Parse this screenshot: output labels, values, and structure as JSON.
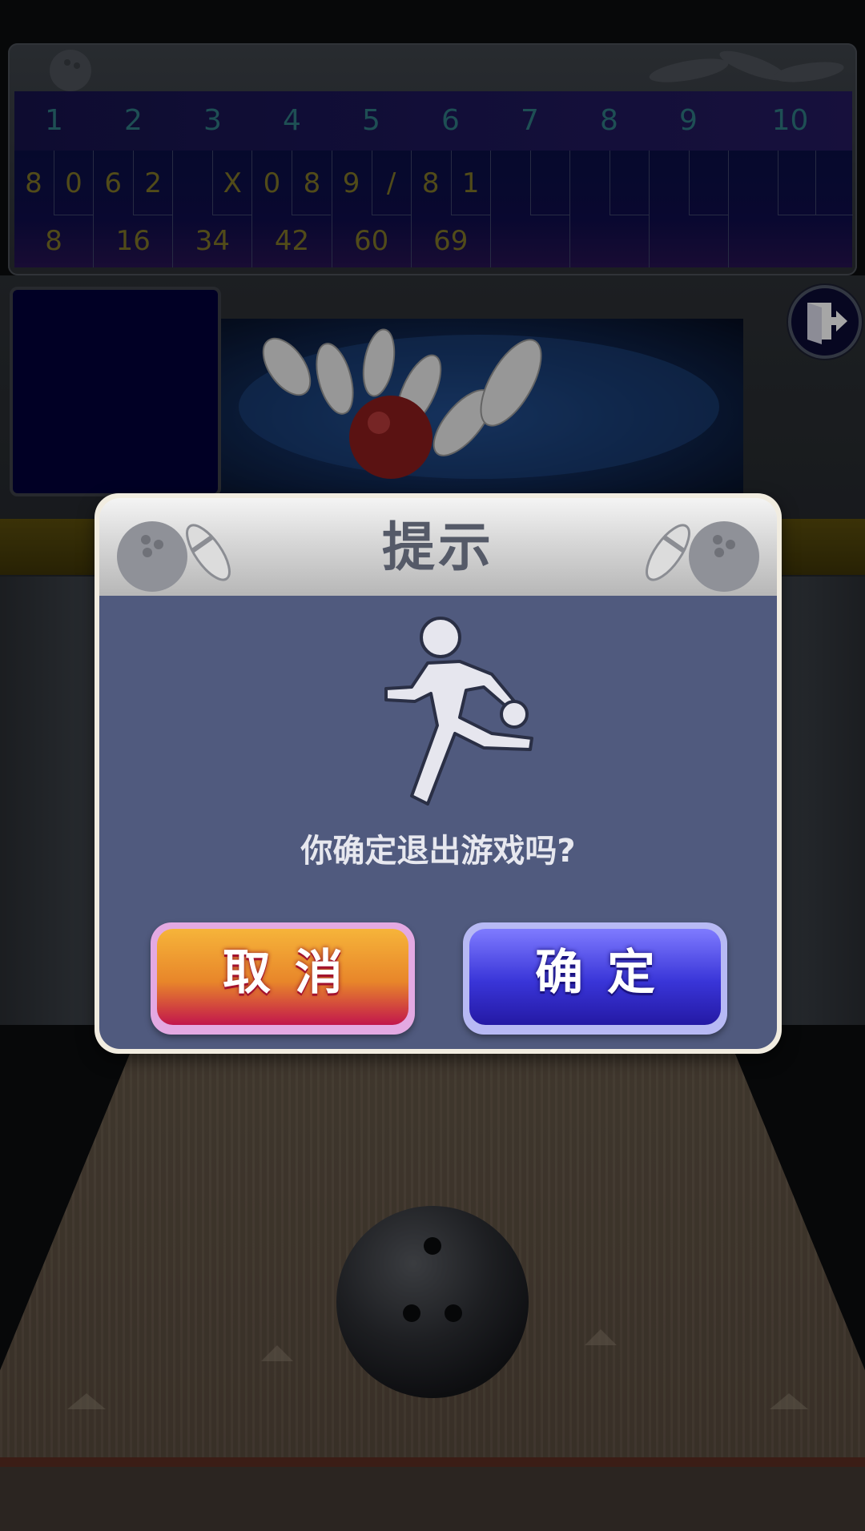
{
  "scoreboard": {
    "frame_numbers": [
      "1",
      "2",
      "3",
      "4",
      "5",
      "6",
      "7",
      "8",
      "9",
      "10"
    ],
    "frames": [
      {
        "r1": "8",
        "r2": "0",
        "score": "8"
      },
      {
        "r1": "6",
        "r2": "2",
        "score": "16"
      },
      {
        "r1": "",
        "r2": "X",
        "score": "34"
      },
      {
        "r1": "0",
        "r2": "8",
        "score": "42"
      },
      {
        "r1": "9",
        "r2": "/",
        "score": "60"
      },
      {
        "r1": "8",
        "r2": "1",
        "score": "69"
      },
      {
        "r1": "",
        "r2": "",
        "score": ""
      },
      {
        "r1": "",
        "r2": "",
        "score": ""
      },
      {
        "r1": "",
        "r2": "",
        "score": ""
      },
      {
        "r1": "",
        "r2": "",
        "r3": "",
        "score": ""
      }
    ]
  },
  "dialog": {
    "title": "提示",
    "message": "你确定退出游戏吗?",
    "cancel_label": "取消",
    "confirm_label": "确定"
  },
  "icons": {
    "exit": "exit-door-icon",
    "bowler": "bowler-icon",
    "header_decor": "ball-and-pin-icon"
  },
  "colors": {
    "dialog_body": "#505a7e",
    "cancel_button": "#e8862a",
    "confirm_button": "#3935d8",
    "score_text": "#7d7327",
    "frame_number_text": "#2e7a82"
  }
}
